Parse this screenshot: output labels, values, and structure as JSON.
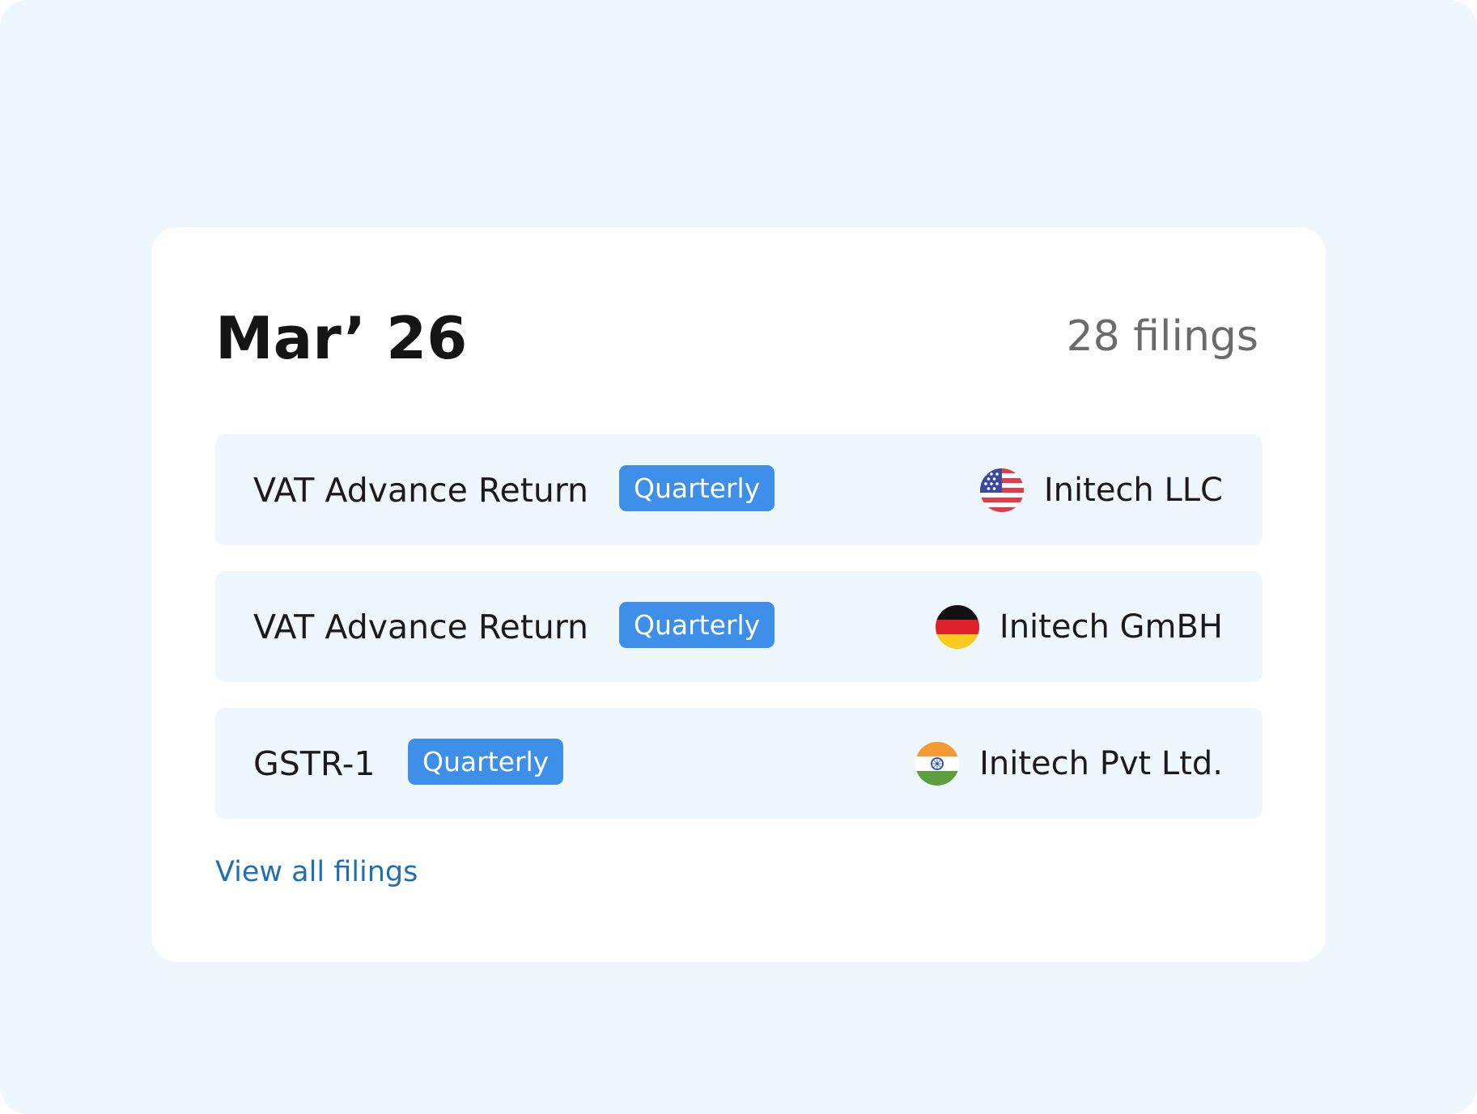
{
  "card": {
    "month": "Mar’ 26",
    "filings_count": "28 filings",
    "view_all_label": "View all filings"
  },
  "filings": [
    {
      "name": "VAT Advance Return",
      "frequency": "Quarterly",
      "entity": "Initech LLC",
      "flag_icon": "us-flag-icon"
    },
    {
      "name": "VAT Advance Return",
      "frequency": "Quarterly",
      "entity": "Initech GmBH",
      "flag_icon": "germany-flag-icon"
    },
    {
      "name": "GSTR-1",
      "frequency": "Quarterly",
      "entity": "Initech Pvt Ltd.",
      "flag_icon": "india-flag-icon"
    }
  ],
  "colors": {
    "background": "#eef6fe",
    "card": "#ffffff",
    "badge": "#3d8fe9",
    "link": "#1f6fb2"
  }
}
